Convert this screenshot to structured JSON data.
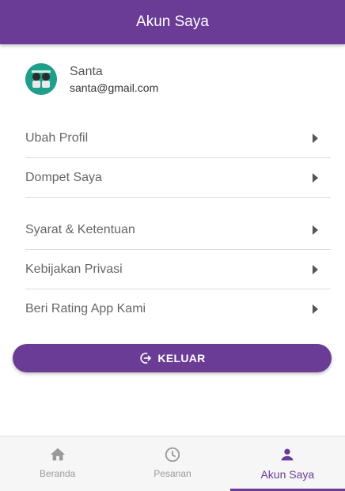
{
  "header": {
    "title": "Akun Saya"
  },
  "profile": {
    "name": "Santa",
    "email": "santa@gmail.com"
  },
  "menu_group_1": [
    {
      "label": "Ubah Profil"
    },
    {
      "label": "Dompet Saya"
    }
  ],
  "menu_group_2": [
    {
      "label": "Syarat & Ketentuan"
    },
    {
      "label": "Kebijakan Privasi"
    },
    {
      "label": "Beri Rating App Kami"
    }
  ],
  "logout": {
    "label": "KELUAR",
    "icon": "logout-icon"
  },
  "bottom_nav": {
    "tabs": [
      {
        "label": "Beranda",
        "icon": "home-icon",
        "active": false
      },
      {
        "label": "Pesanan",
        "icon": "clock-icon",
        "active": false
      },
      {
        "label": "Akun Saya",
        "icon": "person-icon",
        "active": true
      }
    ]
  },
  "colors": {
    "primary": "#6a3c96",
    "avatar_bg": "#1f9e8c"
  }
}
